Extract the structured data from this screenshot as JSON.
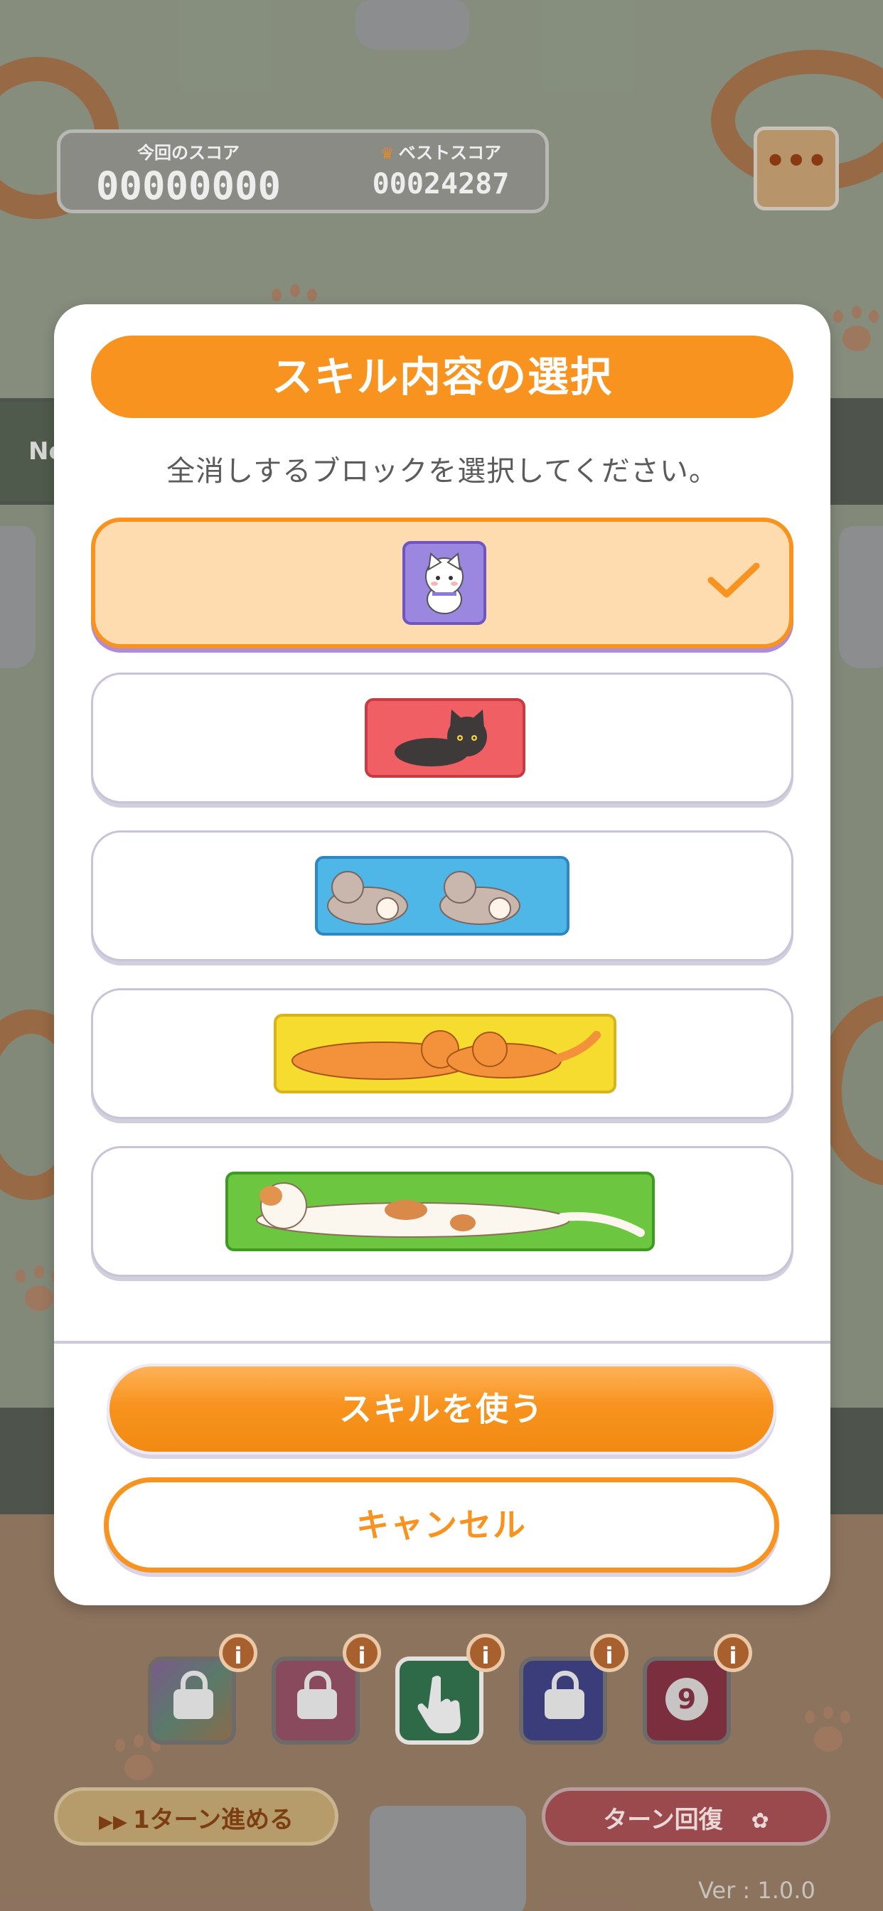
{
  "hud": {
    "current_score_label": "今回のスコア",
    "current_score": "00000000",
    "best_score_label": "ベストスコア",
    "best_score": "00024287",
    "menu_icon": "ellipsis-icon"
  },
  "side_banner_text": "Ne",
  "modal": {
    "title": "スキル内容の選択",
    "description": "全消しするブロックを選択してください。",
    "options": [
      {
        "block": "purple-cat-block",
        "selected": true,
        "check_icon": "checkmark-icon"
      },
      {
        "block": "red-black-cat-block",
        "selected": false
      },
      {
        "block": "blue-two-cats-block",
        "selected": false
      },
      {
        "block": "yellow-orange-cats-block",
        "selected": false
      },
      {
        "block": "green-calico-cat-block",
        "selected": false
      }
    ],
    "use_button": "スキルを使う",
    "cancel_button": "キャンセル"
  },
  "skills": [
    {
      "icon": "lock-icon",
      "info": "i"
    },
    {
      "icon": "lock-icon",
      "info": "i"
    },
    {
      "icon": "pointer-hand-icon",
      "info": "i"
    },
    {
      "icon": "lock-icon",
      "info": "i"
    },
    {
      "icon": "nine-gear-icon",
      "label": "9",
      "info": "i"
    }
  ],
  "bottom": {
    "advance_button": "1ターン進める",
    "recover_button": "ターン回復"
  },
  "version": "Ver : 1.0.0",
  "colors": {
    "accent_orange": "#f7931e",
    "selected_option_bg": "#fedcb0",
    "option_border": "#c9c3d9"
  }
}
